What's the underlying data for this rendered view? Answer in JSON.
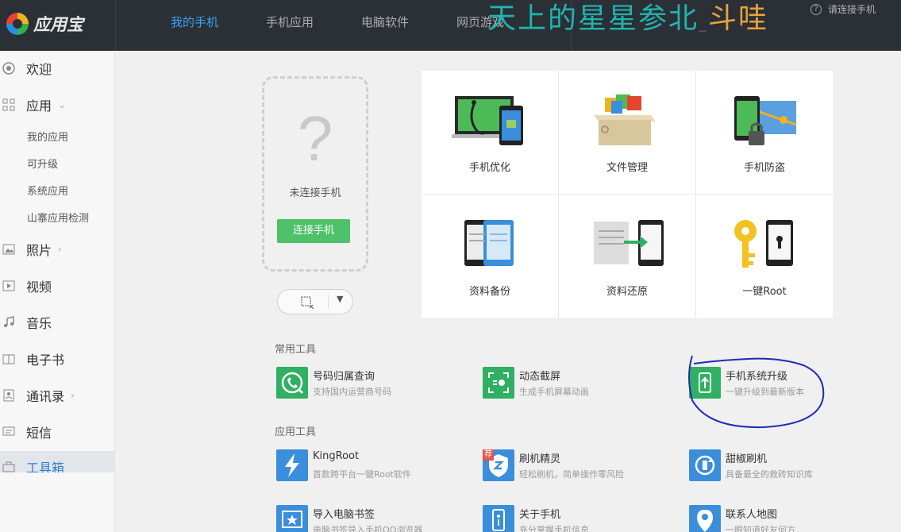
{
  "app": {
    "name": "应用宝"
  },
  "nav": {
    "tabs": [
      {
        "label": "我的手机"
      },
      {
        "label": "手机应用"
      },
      {
        "label": "电脑软件"
      },
      {
        "label": "网页游戏"
      }
    ],
    "active_index": 0,
    "overlay_title_part1": "天上的星星参北",
    "overlay_title_part2": "斗哇",
    "overlay_underscore": "_",
    "connect_phone_link": "请连接手机",
    "help_icon_glyph": "?"
  },
  "sidebar": {
    "welcome": "欢迎",
    "apps": "应用",
    "apps_sub": [
      "我的应用",
      "可升级",
      "系统应用",
      "山寨应用检测"
    ],
    "photos": "照片",
    "videos": "视频",
    "music": "音乐",
    "ebooks": "电子书",
    "contacts": "通讯录",
    "sms": "短信",
    "toolbox": "工具箱"
  },
  "phone": {
    "placeholder_glyph": "?",
    "status": "未连接手机",
    "connect_button": "连接手机"
  },
  "features": [
    {
      "label": "手机优化"
    },
    {
      "label": "文件管理"
    },
    {
      "label": "手机防盗"
    },
    {
      "label": "资料备份"
    },
    {
      "label": "资料还原"
    },
    {
      "label": "一键Root"
    }
  ],
  "sections": {
    "common_tools": "常用工具",
    "app_tools": "应用工具"
  },
  "common_tools": [
    {
      "name": "号码归属查询",
      "desc": "支持国内运营商号码"
    },
    {
      "name": "动态截屏",
      "desc": "生成手机屏幕动画"
    },
    {
      "name": "手机系统升级",
      "desc": "一键升级到最新版本"
    }
  ],
  "app_tools": [
    {
      "name": "KingRoot",
      "desc": "首款跨平台一键Root软件"
    },
    {
      "name": "刷机精灵",
      "desc": "轻松刷机，简单操作零风险",
      "badge": "荐"
    },
    {
      "name": "甜椒刷机",
      "desc": "具备最全的救砖知识库"
    },
    {
      "name": "导入电脑书签",
      "desc": "电脑书签导入手机QQ浏览器"
    },
    {
      "name": "关于手机",
      "desc": "充分掌握手机信息"
    },
    {
      "name": "联系人地图",
      "desc": "一眼知道好友何方"
    }
  ],
  "colors": {
    "topbar": "#2b2f36",
    "accent_blue": "#3ba2f0",
    "green": "#4dc268",
    "annotation": "#1d2ab8"
  }
}
